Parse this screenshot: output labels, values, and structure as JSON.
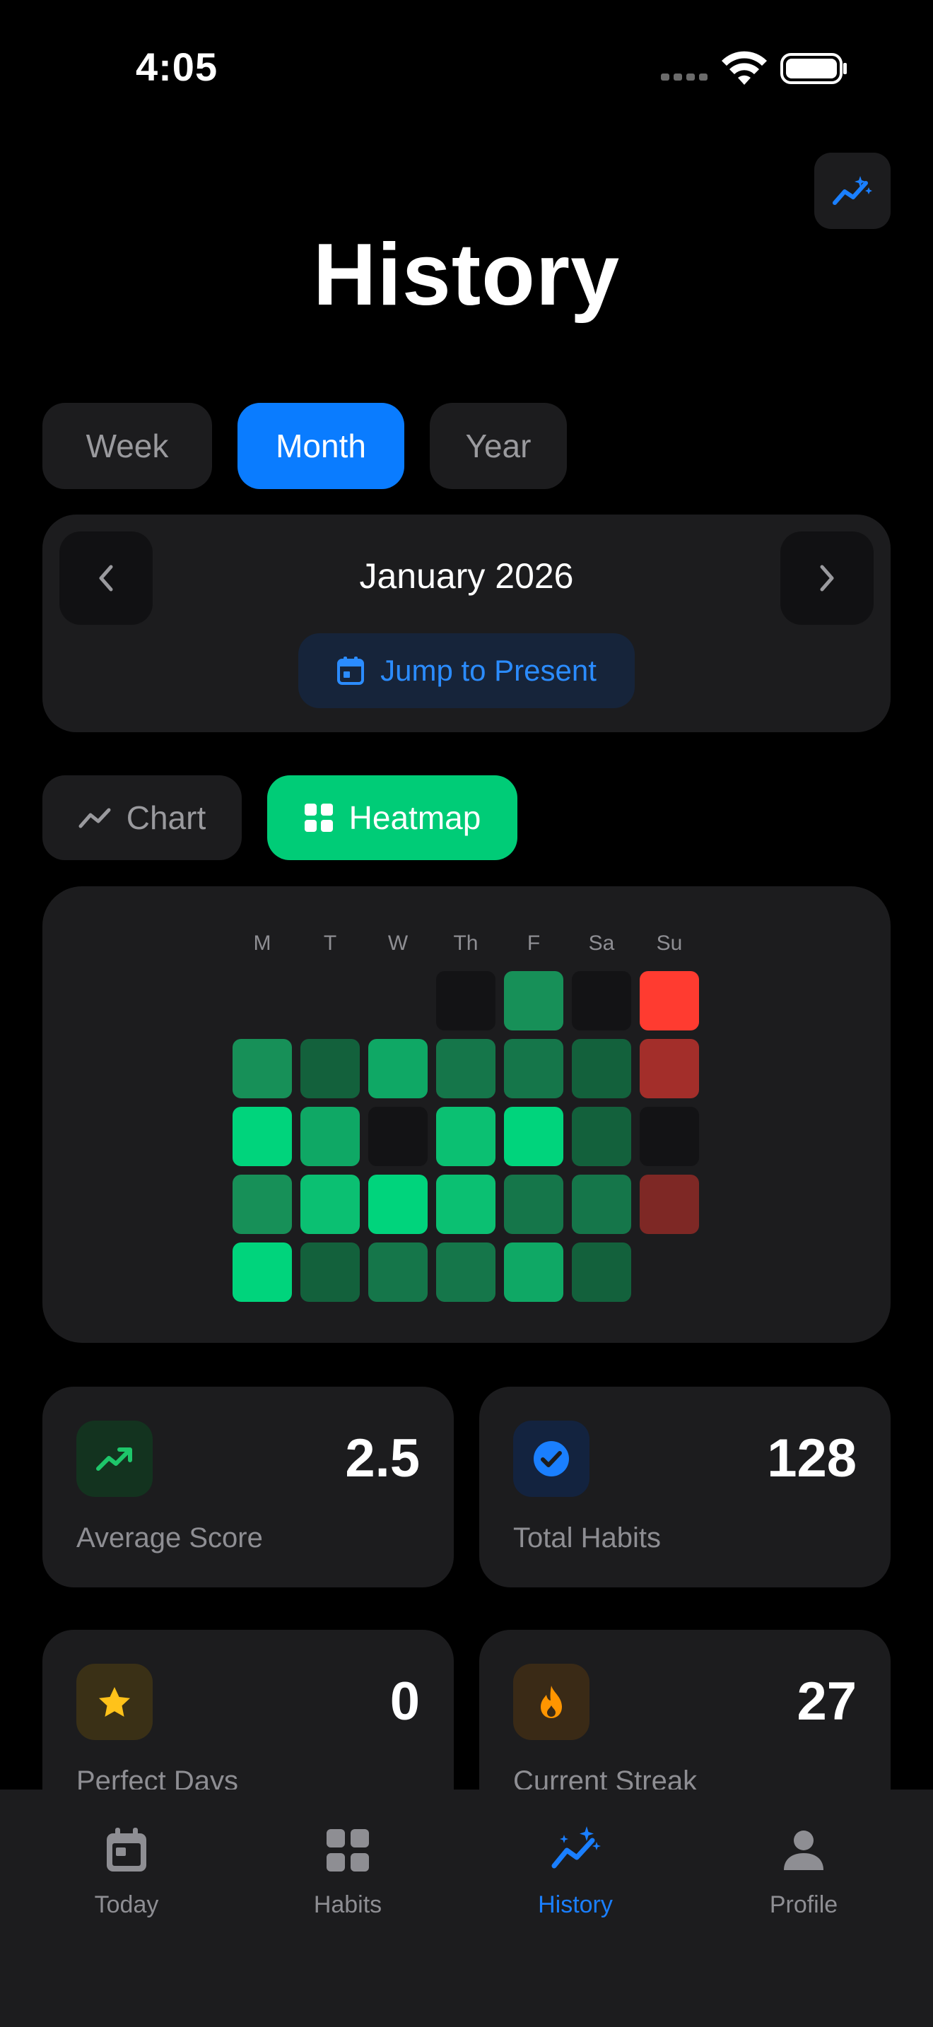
{
  "status_bar": {
    "time": "4:05"
  },
  "header": {
    "title": "History"
  },
  "period_selector": {
    "options": [
      "Week",
      "Month",
      "Year"
    ],
    "selected": "Month"
  },
  "month_nav": {
    "label": "January 2026",
    "jump_label": "Jump to Present"
  },
  "view_toggle": {
    "chart_label": "Chart",
    "heatmap_label": "Heatmap",
    "selected": "Heatmap"
  },
  "heatmap": {
    "day_labels": [
      "M",
      "T",
      "W",
      "Th",
      "F",
      "Sa",
      "Su"
    ],
    "weeks": [
      [
        null,
        null,
        null,
        "empty",
        "green-mid",
        "empty",
        "red-bright"
      ],
      [
        "green-mid",
        "green-dark",
        "green-medium",
        "green-dim",
        "green-dim",
        "green-dark",
        "red-mid"
      ],
      [
        "green-bright",
        "green-medium",
        "empty",
        "green-light",
        "green-bright",
        "green-dark",
        "empty"
      ],
      [
        "green-mid",
        "green-light",
        "green-bright",
        "green-light",
        "green-dim",
        "green-dim",
        "red-dark"
      ],
      [
        "green-bright",
        "green-dark",
        "green-dim",
        "green-dim",
        "green-medium",
        "green-dark",
        null
      ]
    ],
    "colors": {
      "empty": "#131315",
      "green-dark": "#13613c",
      "green-dim": "#15764a",
      "green-mid": "#179058",
      "green-medium": "#0fa865",
      "green-light": "#0bc072",
      "green-bright": "#00d47c",
      "red-bright": "#ff3b30",
      "red-mid": "#a32e2a",
      "red-dark": "#7e2825"
    }
  },
  "stats": [
    {
      "value": "2.5",
      "label": "Average Score",
      "icon": "trending-up-icon"
    },
    {
      "value": "128",
      "label": "Total Habits",
      "icon": "check-circle-icon"
    },
    {
      "value": "0",
      "label": "Perfect Days",
      "icon": "star-icon"
    },
    {
      "value": "27",
      "label": "Current Streak",
      "icon": "flame-icon"
    }
  ],
  "tab_bar": {
    "items": [
      {
        "label": "Today",
        "icon": "calendar-icon"
      },
      {
        "label": "Habits",
        "icon": "grid-icon"
      },
      {
        "label": "History",
        "icon": "analytics-icon"
      },
      {
        "label": "Profile",
        "icon": "person-icon"
      }
    ],
    "active": "History"
  },
  "colors": {
    "accent_blue": "#0a7cff",
    "accent_green": "#00cc77",
    "card_bg": "#1c1c1e"
  }
}
